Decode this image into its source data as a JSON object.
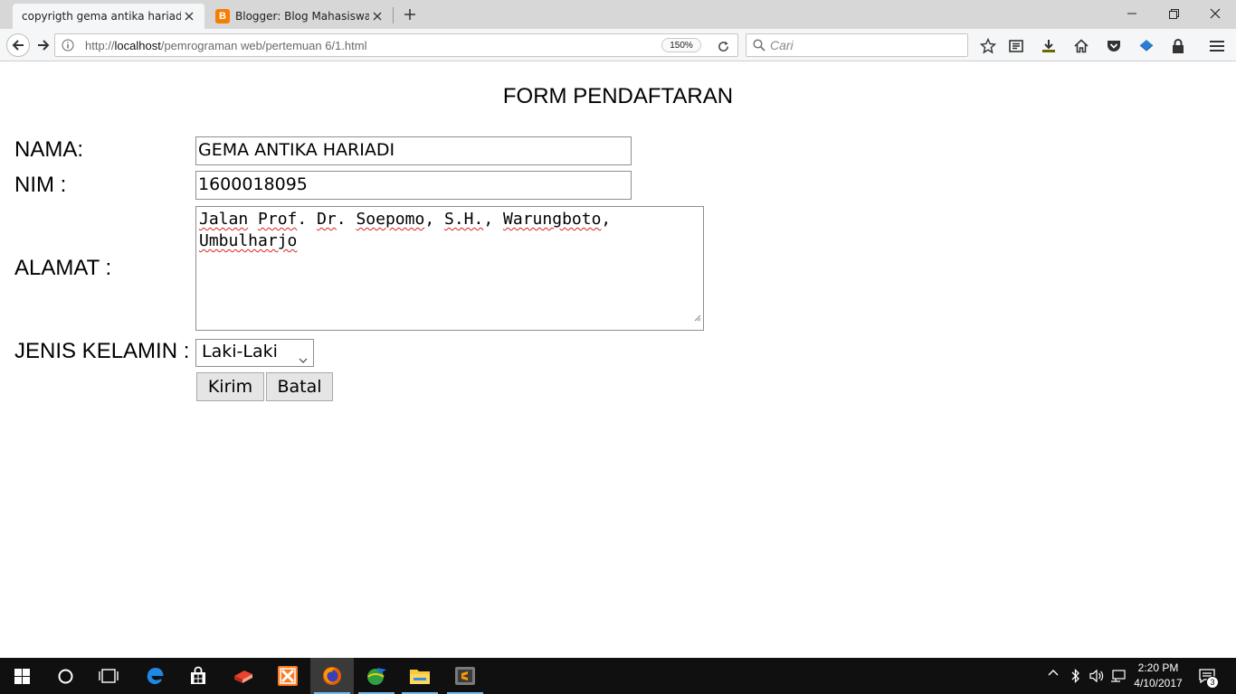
{
  "browser": {
    "tabs": [
      {
        "label": "copyrigth gema antika hariadi",
        "active": true
      },
      {
        "label": "Blogger: Blog Mahasiswa ...",
        "active": false,
        "favicon": "blogger-icon"
      }
    ],
    "url_prefix": "http://",
    "url_host": "localhost",
    "url_path": "/pemrograman web/pertemuan 6/1.html",
    "zoom": "150%",
    "search_placeholder": "Cari"
  },
  "form": {
    "title": "FORM PENDAFTARAN",
    "nama_label": "NAMA:",
    "nama_value": "GEMA ANTIKA HARIADI",
    "nim_label": "NIM :",
    "nim_value": "1600018095",
    "alamat_label": "ALAMAT :",
    "alamat_words": [
      "Jalan",
      "Prof",
      ". ",
      "Dr",
      ". ",
      "Soepomo",
      ", ",
      "S.H.",
      ", ",
      "Warungboto",
      ",",
      "Umbulharjo"
    ],
    "jenis_kelamin_label": "JENIS KELAMIN :",
    "jenis_kelamin_value": "Laki-Laki",
    "submit_label": "Kirim",
    "cancel_label": "Batal"
  },
  "taskbar": {
    "time": "2:20 PM",
    "date": "4/10/2017",
    "notification_count": "3",
    "accent_color": "#76b9ed"
  }
}
